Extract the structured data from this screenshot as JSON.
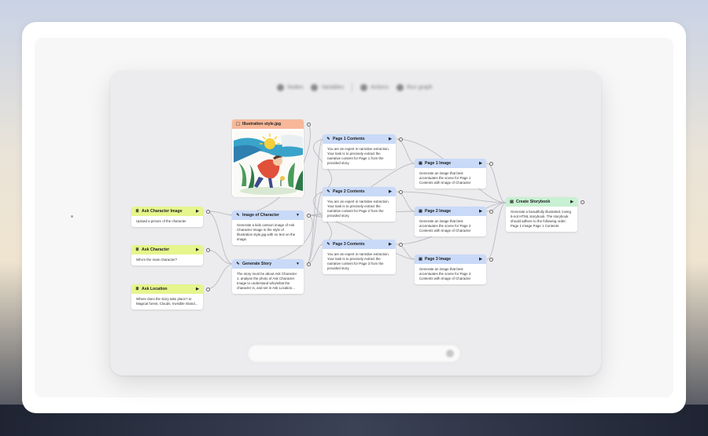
{
  "toolbar": {
    "items": [
      {
        "label": "Nodes",
        "icon": "circle-icon"
      },
      {
        "label": "Variables",
        "icon": "brackets-icon"
      },
      {
        "label": "Actions",
        "icon": "lightning-icon"
      },
      {
        "label": "Run graph",
        "icon": "play-icon"
      }
    ]
  },
  "prompt_bar": {
    "placeholder": ""
  },
  "nodes": {
    "illustration": {
      "title": "Illustration style.jpg"
    },
    "ask_character_image": {
      "title": "Ask Character Image",
      "body": "Upload a picture of the character"
    },
    "ask_character": {
      "title": "Ask Character",
      "body": "Who's the main character?"
    },
    "ask_location": {
      "title": "Ask Location",
      "body": "Where does the story take place? ie: Magical forest, Clouds, Invisible Island..."
    },
    "image_of_character": {
      "title": "Image of Character",
      "body": "Generate a kids cartoon image of Ask Character Image in the style of Illustration style.jpg with no text on the image."
    },
    "generate_story": {
      "title": "Generate Story",
      "body": "The story must be about Ask Character 1. analyse the photo of Ask Character Image to understand who/what the character is, and set in Ask Location..."
    },
    "page1_contents": {
      "title": "Page 1 Contents",
      "body": "You are an expert in narrative extraction. Your task is to precisely extract the narrative content for Page 1 from the provided story."
    },
    "page2_contents": {
      "title": "Page 2 Contents",
      "body": "You are an expert in narrative extraction. Your task is to precisely extract the narrative content for Page 2 from the provided story."
    },
    "page3_contents": {
      "title": "Page 3 Contents",
      "body": "You are an expert in narrative extraction. Your task is to precisely extract the narrative content for Page 3 from the provided story."
    },
    "page1_image": {
      "title": "Page 1 Image",
      "body": "Generate an image that best accentuates the scene for Page 1 Contents with Image of Character"
    },
    "page2_image": {
      "title": "Page 2 Image",
      "body": "Generate an image that best accentuates the scene for Page 2 Contents with Image of Character"
    },
    "page3_image": {
      "title": "Page 3 Image",
      "body": "Generate an image that best accentuates the scene for Page 3 Contents with Image of Character"
    },
    "create_storybook": {
      "title": "Create Storybook",
      "body": "Generate a beautifully illustrated, loving 6-not HTML storybook. The storybook should adhere to the following order: Page 1 Image Page 1 Contents"
    }
  },
  "colors": {
    "input_node": "#e6f58c",
    "generate_node": "#c9daf8",
    "output_node": "#c8f0d2",
    "asset_node": "#f7b89a"
  }
}
